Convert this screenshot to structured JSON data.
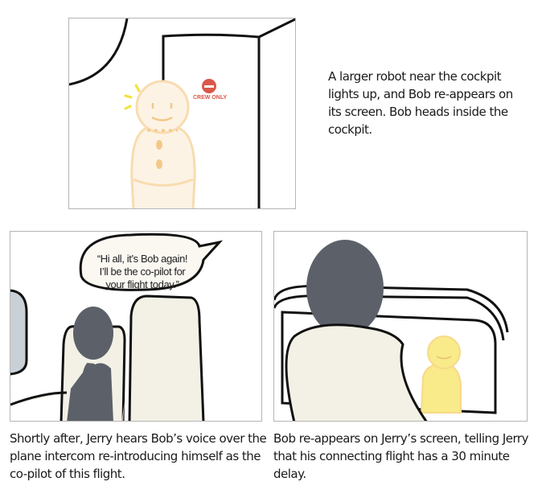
{
  "panels": [
    {
      "caption": "A larger robot near the cockpit lights up, and Bob re-appears on its screen. Bob heads inside the cockpit.",
      "sign_text": "CREW ONLY",
      "colors": {
        "robot_fill": "#fdf3e5",
        "robot_outline": "#f8dcb0",
        "sign": "#d9574a",
        "glow": "#f2e23a"
      }
    },
    {
      "caption": "Shortly after, Jerry hears Bob’s voice over the plane intercom re-introducing himself as the co-pilot of this flight.",
      "speech": "“Hi all, it’s Bob again! I’ll be the co-pilot for your flight today.”",
      "colors": {
        "seat": "#f3f1e6",
        "person": "#5c6169"
      }
    },
    {
      "caption": "Bob re-appears on Jerry’s screen, telling Jerry that his connecting flight has a 30 minute delay.",
      "colors": {
        "screen_robot": "#f9ea8a",
        "person": "#5c6169"
      }
    }
  ]
}
